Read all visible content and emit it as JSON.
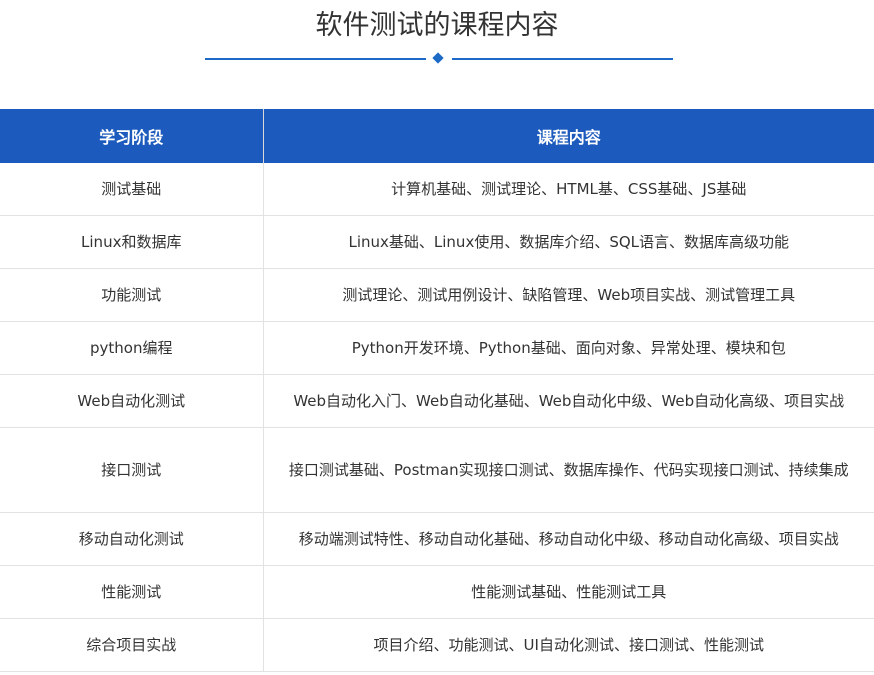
{
  "title": "软件测试的课程内容",
  "accent_color": "#1c5bbd",
  "table": {
    "headers": [
      "学习阶段",
      "课程内容"
    ],
    "rows": [
      {
        "stage": "测试基础",
        "content": "计算机基础、测试理论、HTML基、CSS基础、JS基础"
      },
      {
        "stage": "Linux和数据库",
        "content": "Linux基础、Linux使用、数据库介绍、SQL语言、数据库高级功能"
      },
      {
        "stage": "功能测试",
        "content": "测试理论、测试用例设计、缺陷管理、Web项目实战、测试管理工具"
      },
      {
        "stage": "python编程",
        "content": "Python开发环境、Python基础、面向对象、异常处理、模块和包"
      },
      {
        "stage": "Web自动化测试",
        "content": "Web自动化入门、Web自动化基础、Web自动化中级、Web自动化高级、项目实战"
      },
      {
        "stage": "接口测试",
        "content": "接口测试基础、Postman实现接口测试、数据库操作、代码实现接口测试、持续集成"
      },
      {
        "stage": "移动自动化测试",
        "content": "移动端测试特性、移动自动化基础、移动自动化中级、移动自动化高级、项目实战"
      },
      {
        "stage": "性能测试",
        "content": "性能测试基础、性能测试工具"
      },
      {
        "stage": "综合项目实战",
        "content": "项目介绍、功能测试、UI自动化测试、接口测试、性能测试"
      }
    ]
  }
}
